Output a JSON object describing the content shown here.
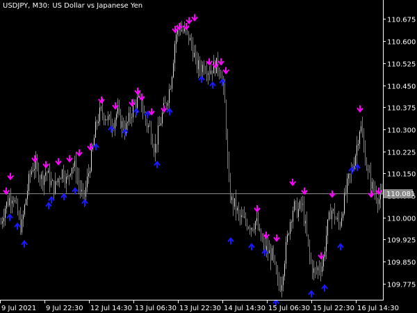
{
  "header": {
    "symbol": "USDJPY, M30:",
    "description": "US Dollar vs Japanese Yen"
  },
  "colors": {
    "background": "#000000",
    "axis": "#ffffff",
    "text": "#ffffff",
    "candle": "#ff3a78",
    "candle_up_body": "#ffd9e4",
    "arrow_down": "#ff00ff",
    "arrow_up": "#1a1aff",
    "price_line": "#888888",
    "price_tag_bg": "#888888"
  },
  "chart_data": {
    "type": "candlestick",
    "title": "USDJPY, M30:  US Dollar vs Japanese Yen",
    "ylim": [
      109.72,
      110.74
    ],
    "y_ticks": [
      109.775,
      109.85,
      109.925,
      110.0,
      110.075,
      110.15,
      110.225,
      110.3,
      110.375,
      110.45,
      110.525,
      110.6,
      110.675
    ],
    "y_tick_labels": [
      "109.775",
      "109.850",
      "109.925",
      "110.000",
      "110.075",
      "110.150",
      "110.225",
      "110.300",
      "110.375",
      "110.450",
      "110.525",
      "110.600",
      "110.675"
    ],
    "x_tick_labels": [
      "9 Jul 2021",
      "9 Jul 22:30",
      "12 Jul 14:30",
      "13 Jul 06:30",
      "13 Jul 22:30",
      "14 Jul 14:30",
      "15 Jul 06:30",
      "15 Jul 22:30",
      "16 Jul 14:30"
    ],
    "current_price": 110.081,
    "current_price_label": "110.081",
    "close_path": [
      [
        0,
        109.97
      ],
      [
        6,
        110.03
      ],
      [
        12,
        110.06
      ],
      [
        18,
        110.08
      ],
      [
        24,
        110.02
      ],
      [
        30,
        109.96
      ],
      [
        36,
        110.05
      ],
      [
        42,
        110.14
      ],
      [
        48,
        110.18
      ],
      [
        54,
        110.16
      ],
      [
        60,
        110.13
      ],
      [
        66,
        110.16
      ],
      [
        72,
        110.12
      ],
      [
        78,
        110.1
      ],
      [
        84,
        110.14
      ],
      [
        90,
        110.16
      ],
      [
        96,
        110.12
      ],
      [
        102,
        110.18
      ],
      [
        108,
        110.17
      ],
      [
        114,
        110.1
      ],
      [
        120,
        110.06
      ],
      [
        126,
        110.14
      ],
      [
        132,
        110.22
      ],
      [
        138,
        110.32
      ],
      [
        144,
        110.36
      ],
      [
        150,
        110.35
      ],
      [
        156,
        110.33
      ],
      [
        162,
        110.32
      ],
      [
        168,
        110.36
      ],
      [
        174,
        110.32
      ],
      [
        180,
        110.3
      ],
      [
        186,
        110.34
      ],
      [
        192,
        110.38
      ],
      [
        198,
        110.4
      ],
      [
        204,
        110.38
      ],
      [
        210,
        110.32
      ],
      [
        216,
        110.3
      ],
      [
        222,
        110.23
      ],
      [
        228,
        110.3
      ],
      [
        234,
        110.36
      ],
      [
        240,
        110.4
      ],
      [
        246,
        110.47
      ],
      [
        252,
        110.62
      ],
      [
        258,
        110.65
      ],
      [
        264,
        110.63
      ],
      [
        270,
        110.62
      ],
      [
        276,
        110.58
      ],
      [
        282,
        110.52
      ],
      [
        288,
        110.51
      ],
      [
        294,
        110.52
      ],
      [
        300,
        110.5
      ],
      [
        306,
        110.51
      ],
      [
        312,
        110.52
      ],
      [
        318,
        110.49
      ],
      [
        324,
        110.36
      ],
      [
        328,
        110.12
      ],
      [
        332,
        110.06
      ],
      [
        338,
        110.04
      ],
      [
        344,
        110.0
      ],
      [
        350,
        109.99
      ],
      [
        356,
        109.98
      ],
      [
        362,
        109.97
      ],
      [
        368,
        109.99
      ],
      [
        374,
        109.93
      ],
      [
        380,
        109.9
      ],
      [
        386,
        109.88
      ],
      [
        392,
        109.87
      ],
      [
        398,
        109.78
      ],
      [
        404,
        109.77
      ],
      [
        410,
        109.88
      ],
      [
        416,
        109.98
      ],
      [
        422,
        110.04
      ],
      [
        428,
        110.02
      ],
      [
        434,
        110.05
      ],
      [
        440,
        109.95
      ],
      [
        446,
        109.85
      ],
      [
        452,
        109.81
      ],
      [
        458,
        109.83
      ],
      [
        464,
        109.84
      ],
      [
        470,
        109.96
      ],
      [
        476,
        110.03
      ],
      [
        482,
        110.0
      ],
      [
        488,
        109.97
      ],
      [
        494,
        110.05
      ],
      [
        500,
        110.12
      ],
      [
        506,
        110.16
      ],
      [
        512,
        110.23
      ],
      [
        518,
        110.32
      ],
      [
        522,
        110.25
      ],
      [
        528,
        110.16
      ],
      [
        534,
        110.11
      ],
      [
        540,
        110.08
      ],
      [
        546,
        110.06
      ],
      [
        551,
        110.08
      ]
    ],
    "series": [
      {
        "name": "down signals",
        "marker": "down-arrow",
        "points": [
          [
            9,
            110.09
          ],
          [
            15,
            110.14
          ],
          [
            50,
            110.2
          ],
          [
            66,
            110.18
          ],
          [
            84,
            110.19
          ],
          [
            100,
            110.2
          ],
          [
            114,
            110.22
          ],
          [
            130,
            110.24
          ],
          [
            146,
            110.4
          ],
          [
            166,
            110.38
          ],
          [
            190,
            110.39
          ],
          [
            198,
            110.43
          ],
          [
            204,
            110.41
          ],
          [
            218,
            110.36
          ],
          [
            236,
            110.37
          ],
          [
            252,
            110.64
          ],
          [
            258,
            110.65
          ],
          [
            268,
            110.65
          ],
          [
            272,
            110.67
          ],
          [
            280,
            110.68
          ],
          [
            301,
            110.53
          ],
          [
            310,
            110.52
          ],
          [
            318,
            110.53
          ],
          [
            325,
            110.5
          ],
          [
            370,
            110.03
          ],
          [
            383,
            109.94
          ],
          [
            398,
            109.93
          ],
          [
            421,
            110.12
          ],
          [
            438,
            110.09
          ],
          [
            462,
            109.87
          ],
          [
            478,
            110.08
          ],
          [
            518,
            110.37
          ],
          [
            534,
            110.08
          ],
          [
            545,
            110.09
          ]
        ]
      },
      {
        "name": "up signals",
        "marker": "up-arrow",
        "points": [
          [
            14,
            110.0
          ],
          [
            25,
            109.97
          ],
          [
            35,
            109.91
          ],
          [
            70,
            110.04
          ],
          [
            74,
            110.06
          ],
          [
            92,
            110.07
          ],
          [
            108,
            110.09
          ],
          [
            122,
            110.05
          ],
          [
            138,
            110.24
          ],
          [
            160,
            110.3
          ],
          [
            180,
            110.29
          ],
          [
            196,
            110.36
          ],
          [
            212,
            110.35
          ],
          [
            226,
            110.18
          ],
          [
            244,
            110.36
          ],
          [
            290,
            110.47
          ],
          [
            306,
            110.45
          ],
          [
            320,
            110.46
          ],
          [
            332,
            109.92
          ],
          [
            362,
            109.9
          ],
          [
            381,
            109.88
          ],
          [
            397,
            109.71
          ],
          [
            448,
            109.74
          ],
          [
            467,
            109.76
          ],
          [
            490,
            109.9
          ],
          [
            506,
            110.16
          ],
          [
            514,
            110.17
          ]
        ]
      }
    ]
  }
}
